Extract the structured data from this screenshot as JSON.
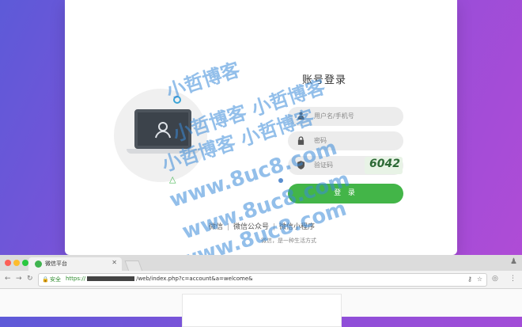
{
  "login": {
    "title": "账号登录",
    "username_placeholder": "用户名/手机号",
    "password_placeholder": "密码",
    "captcha_placeholder": "验证码",
    "captcha_text": "6042",
    "submit_label": "登 录",
    "links": [
      "微信",
      "微信公众号",
      "微信小程序"
    ],
    "slogan": "微信，是一种生活方式"
  },
  "icons": {
    "user_field": "user-icon",
    "password_field": "lock-icon",
    "captcha_field": "shield-icon"
  },
  "watermark": [
    "小哲博客",
    "小哲博客 小哲博客",
    "小哲博客 小哲博客",
    "www.8uc8.com",
    "www.8uc8.com",
    "www.8uc8.com"
  ],
  "browser": {
    "tab_title": "微信平台",
    "secure_label": "安全",
    "url_scheme": "https://",
    "url_path": "/web/index.php?c=account&a=welcome&",
    "colors": {
      "close": "#fc5f57",
      "minimize": "#fdbc2e",
      "maximize": "#29c840"
    }
  },
  "colors": {
    "accent": "#43b548",
    "background_start": "#5d5ad8",
    "background_end": "#b24bd6"
  }
}
